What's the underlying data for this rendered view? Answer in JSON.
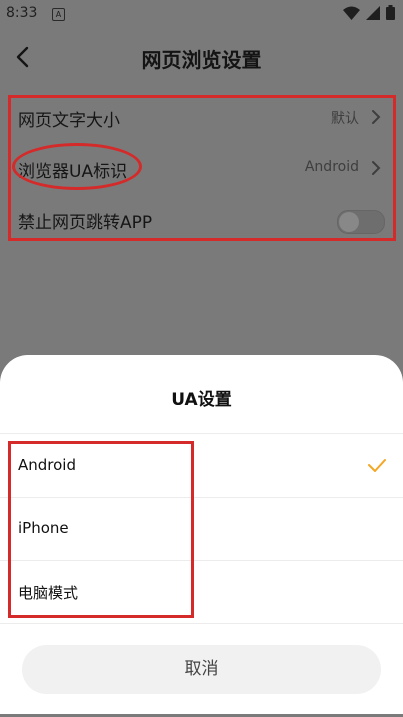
{
  "status_bar": {
    "time": "8:33",
    "app_icon_letter": "A"
  },
  "header": {
    "title": "网页浏览设置"
  },
  "settings": [
    {
      "label": "网页文字大小",
      "value": "默认"
    },
    {
      "label": "浏览器UA标识",
      "value": "Android"
    },
    {
      "label": "禁止网页跳转APP",
      "toggle_on": false
    }
  ],
  "sheet": {
    "title": "UA设置",
    "options": [
      {
        "label": "Android",
        "selected": true
      },
      {
        "label": "iPhone",
        "selected": false
      },
      {
        "label": "电脑模式",
        "selected": false
      }
    ],
    "cancel_label": "取消"
  },
  "colors": {
    "accent": "#f5a623",
    "annotation": "#d42a2a",
    "overlay": "#7a7a7a"
  }
}
